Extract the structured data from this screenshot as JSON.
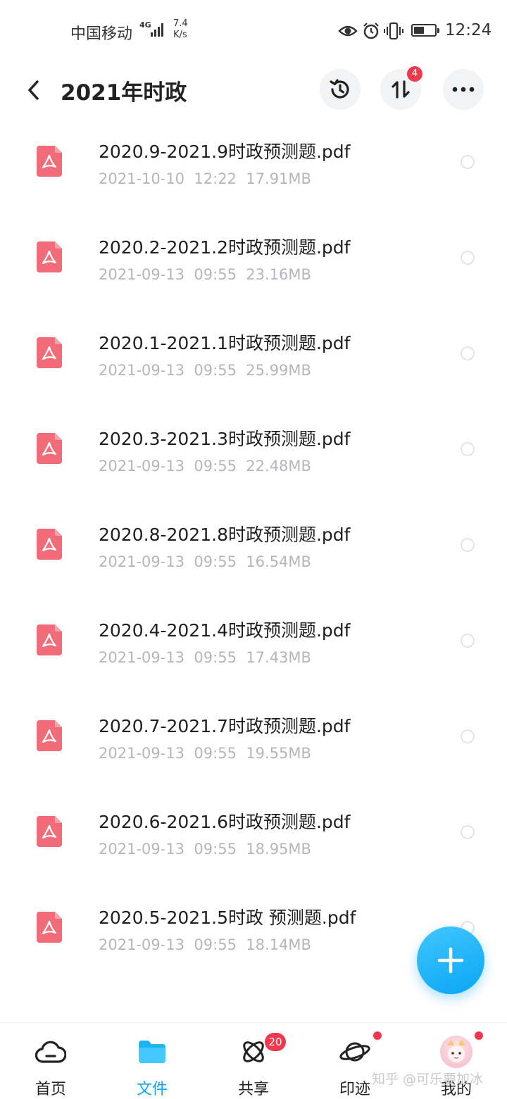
{
  "status_bar": {
    "carrier": "中国移动",
    "network_type": "4G",
    "speed_value": "7.4",
    "speed_unit": "K/s",
    "time": "12:24",
    "icons": [
      "eye-icon",
      "alarm-icon",
      "vibrate-icon",
      "battery-icon"
    ]
  },
  "header": {
    "title": "2021年时政",
    "back_icon": "chevron-left-icon",
    "buttons": [
      {
        "name": "history",
        "icon": "history-icon"
      },
      {
        "name": "transfer",
        "icon": "transfer-icon",
        "badge": "4"
      },
      {
        "name": "more",
        "icon": "more-icon"
      }
    ]
  },
  "files": [
    {
      "name": "2020.9-2021.9时政预测题.pdf",
      "date": "2021-10-10",
      "time": "12:22",
      "size": "17.91MB"
    },
    {
      "name": "2020.2-2021.2时政预测题.pdf",
      "date": "2021-09-13",
      "time": "09:55",
      "size": "23.16MB"
    },
    {
      "name": "2020.1-2021.1时政预测题.pdf",
      "date": "2021-09-13",
      "time": "09:55",
      "size": "25.99MB"
    },
    {
      "name": "2020.3-2021.3时政预测题.pdf",
      "date": "2021-09-13",
      "time": "09:55",
      "size": "22.48MB"
    },
    {
      "name": "2020.8-2021.8时政预测题.pdf",
      "date": "2021-09-13",
      "time": "09:55",
      "size": "16.54MB"
    },
    {
      "name": "2020.4-2021.4时政预测题.pdf",
      "date": "2021-09-13",
      "time": "09:55",
      "size": "17.43MB"
    },
    {
      "name": "2020.7-2021.7时政预测题.pdf",
      "date": "2021-09-13",
      "time": "09:55",
      "size": "19.55MB"
    },
    {
      "name": "2020.6-2021.6时政预测题.pdf",
      "date": "2021-09-13",
      "time": "09:55",
      "size": "18.95MB"
    },
    {
      "name": "2020.5-2021.5时政 预测题.pdf",
      "date": "2021-09-13",
      "time": "09:55",
      "size": "18.14MB"
    }
  ],
  "fab": {
    "icon": "plus-icon"
  },
  "bottom_nav": {
    "items": [
      {
        "label": "首页",
        "icon": "cloud-icon",
        "active": false
      },
      {
        "label": "文件",
        "icon": "folder-icon",
        "active": true
      },
      {
        "label": "共享",
        "icon": "atom-icon",
        "badge": "20",
        "active": false
      },
      {
        "label": "印迹",
        "icon": "planet-icon",
        "dot": true,
        "active": false
      },
      {
        "label": "我的",
        "icon": "avatar",
        "dot": true,
        "active": false
      }
    ]
  },
  "watermark": "知乎 @可乐要加冰",
  "colors": {
    "accent": "#12a8f0",
    "pdf_icon": "#f26b78",
    "badge": "#f0394e",
    "meta_text": "#b3b6bc"
  }
}
